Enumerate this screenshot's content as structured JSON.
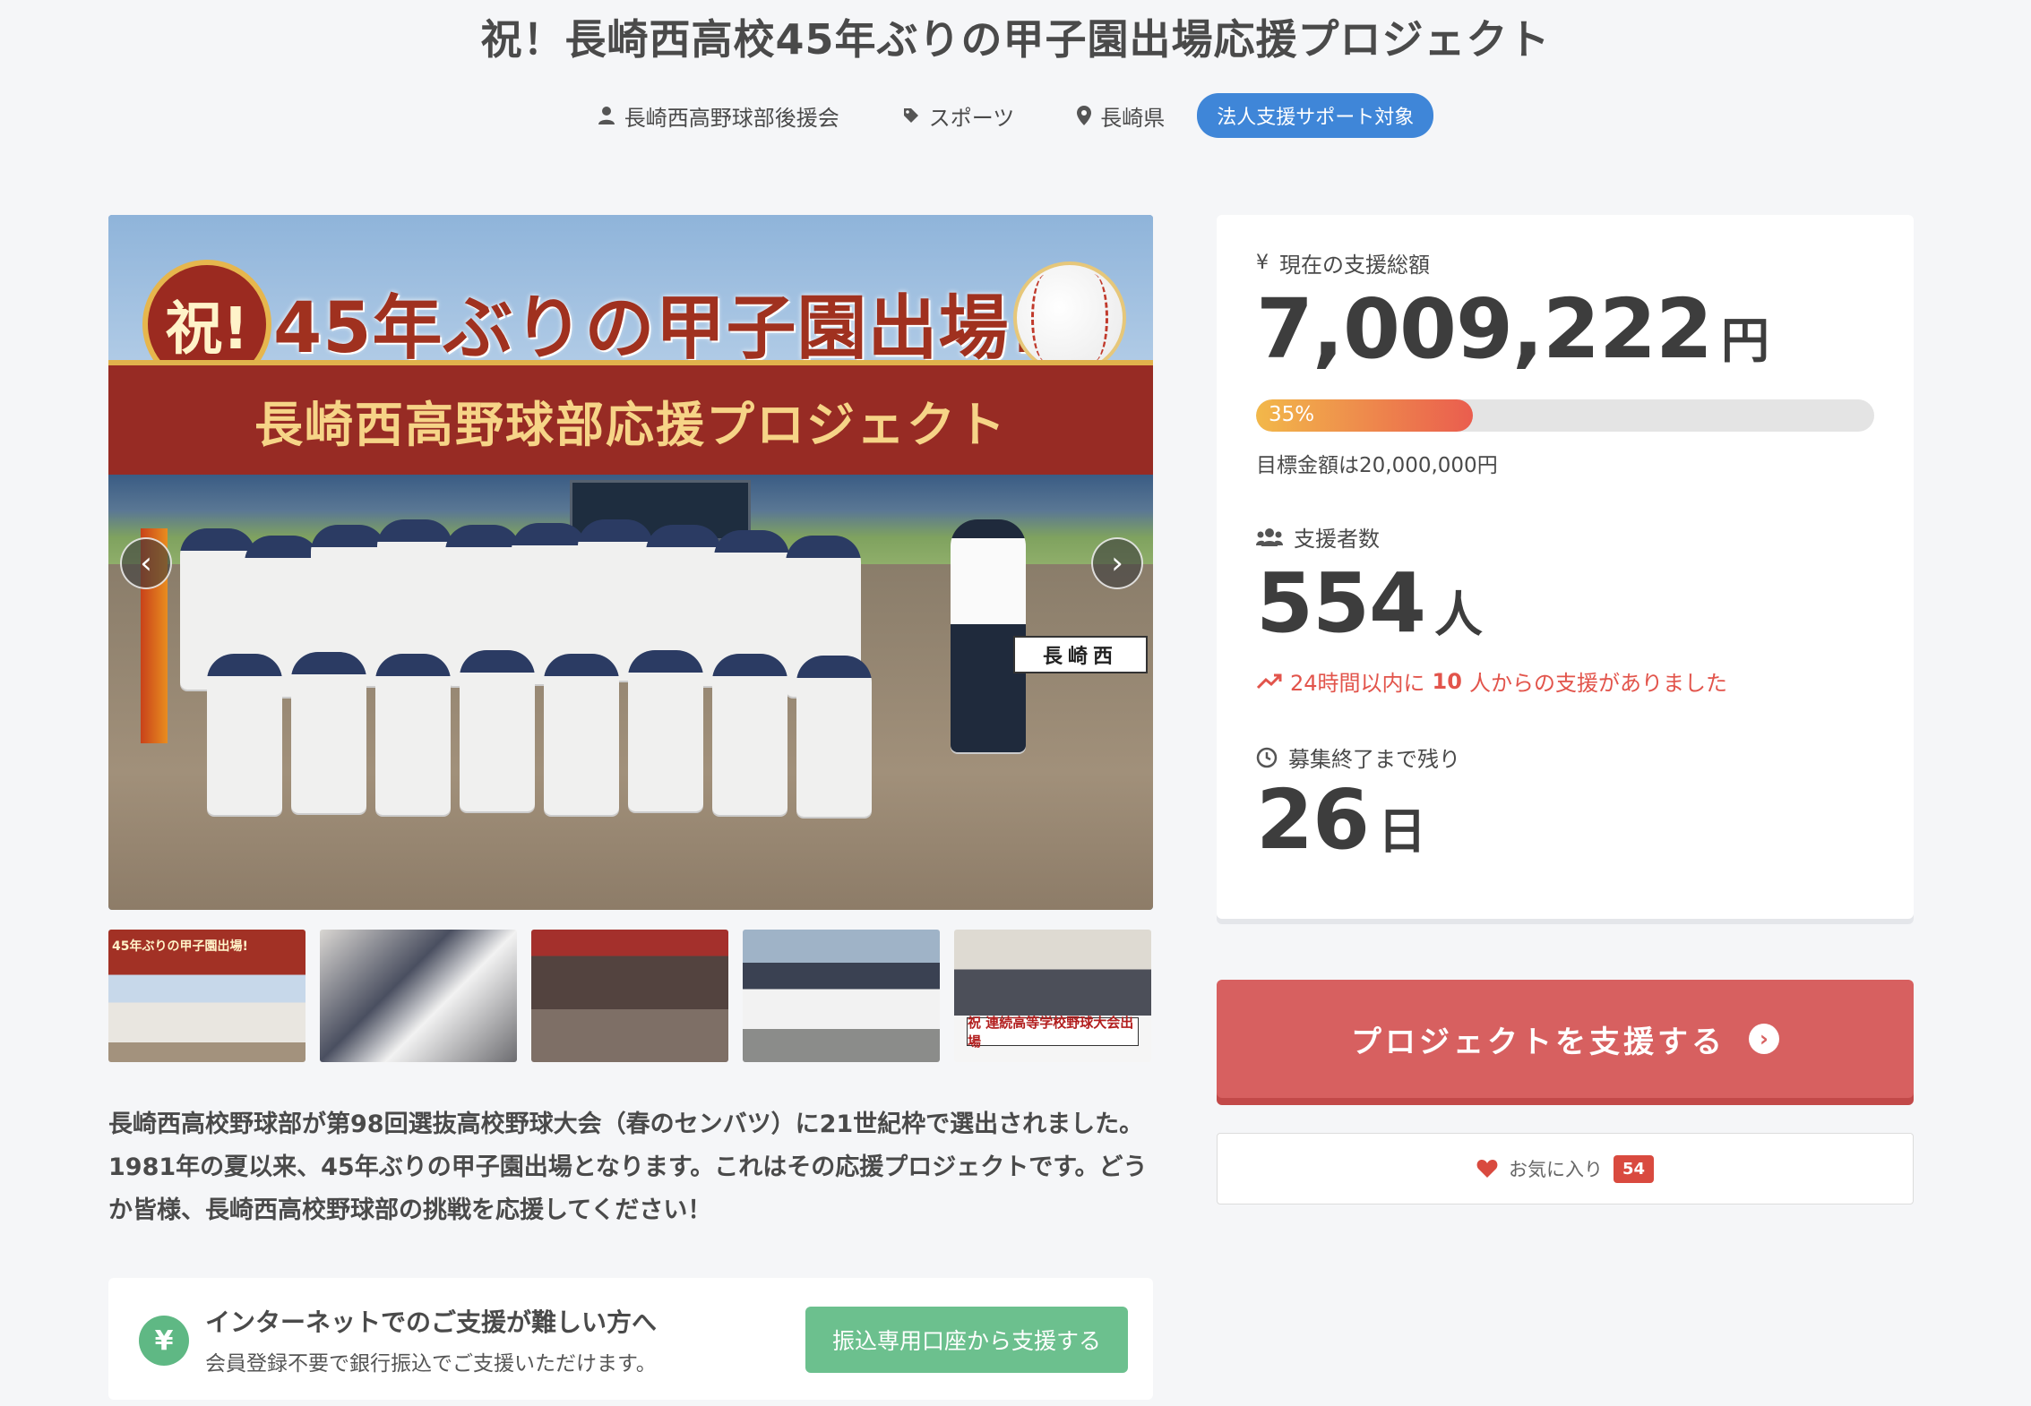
{
  "title": "祝！長崎西高校45年ぶりの甲子園出場応援プロジェクト",
  "meta": {
    "owner": "長崎西高野球部後援会",
    "category": "スポーツ",
    "location": "長崎県",
    "badge": "法人支援サポート対象"
  },
  "hero": {
    "circle_text": "祝!",
    "headline": "45年ぶりの甲子園出場!",
    "band_text": "長崎西高野球部応援プロジェクト",
    "sign_text": "長崎西"
  },
  "thumbs": {
    "t1_label": "45年ぶりの甲子園出場!",
    "t5_label": "祝 連続高等学校野球大会出場"
  },
  "description": "長崎西高校野球部が第98回選抜高校野球大会（春のセンバツ）に21世紀枠で選出されました。1981年の夏以来、45年ぶりの甲子園出場となります。これはその応援プロジェクトです。どうか皆様、長崎西高校野球部の挑戦を応援してください！",
  "bank": {
    "title": "インターネットでのご支援が難しい方へ",
    "subtitle": "会員登録不要で銀行振込でご支援いただけます。",
    "button": "振込専用口座から支援する",
    "icon": "¥"
  },
  "stats": {
    "amount_label": "現在の支援総額",
    "amount": "7,009,222",
    "amount_unit": "円",
    "progress_percent": 35,
    "progress_label": "35%",
    "goal": "目標金額は20,000,000円",
    "supporters_label": "支援者数",
    "supporters": "554",
    "supporters_unit": "人",
    "trend_prefix": "24時間以内に",
    "trend_count": "10",
    "trend_suffix": "人からの支援がありました",
    "remaining_label": "募集終了まで残り",
    "remaining": "26",
    "remaining_unit": "日"
  },
  "support_button": "プロジェクトを支援する",
  "favorite": {
    "label": "お気に入り",
    "count": "54"
  },
  "colors": {
    "accent_blue": "#3f86d8",
    "support_red": "#d76060",
    "bank_green": "#6cc08e",
    "trend_red": "#e2544b"
  }
}
